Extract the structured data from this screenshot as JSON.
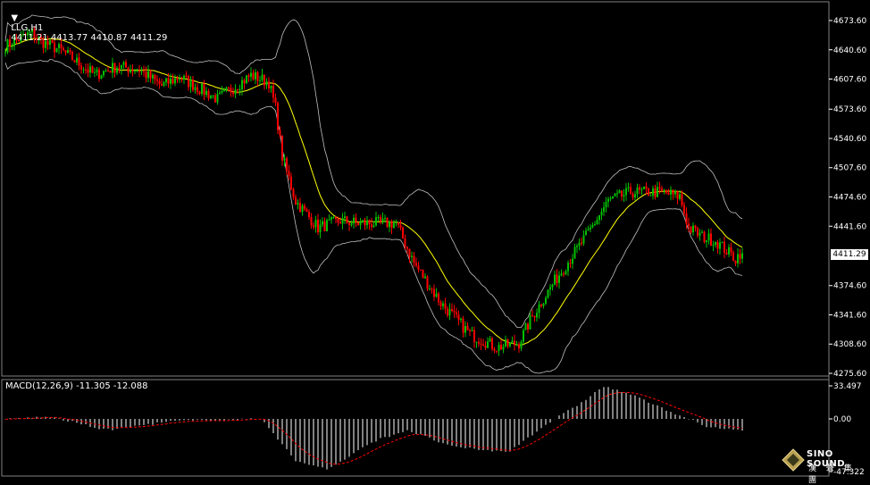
{
  "header": {
    "symbol": "LLG,H1",
    "ohlc": "4411.21 4413.77 4410.87 4411.29"
  },
  "macd_header": "MACD(12,26,9) -11.305 -12.088",
  "price_axis": {
    "ticks": [
      "4673.60",
      "4640.60",
      "4607.60",
      "4573.60",
      "4540.60",
      "4507.60",
      "4474.60",
      "4441.60",
      "4374.60",
      "4341.60",
      "4308.60",
      "4275.60"
    ],
    "current_price": "4411.29"
  },
  "macd_axis": {
    "ticks": [
      "33.497",
      "0.00",
      "-47.322"
    ]
  },
  "logo": {
    "en": "SINO SOUND",
    "zh": "漢 聲 集 團"
  },
  "colors": {
    "background": "#000000",
    "up_candle": "#00c000",
    "down_candle": "#ff0000",
    "middle_band": "#ffff00",
    "bands": "#c0c0c0",
    "macd_hist": "#ffffff",
    "macd_signal": "#ff0000",
    "grid": "#808080"
  },
  "chart_data": {
    "type": "candlestick",
    "title": "LLG,H1",
    "price_range": [
      4275.6,
      4673.6
    ],
    "current_price": 4411.29,
    "bollinger_bands": true,
    "close_anchors": [
      [
        0,
        4645
      ],
      [
        8,
        4655
      ],
      [
        12,
        4660
      ],
      [
        16,
        4650
      ],
      [
        25,
        4640
      ],
      [
        40,
        4612
      ],
      [
        50,
        4622
      ],
      [
        60,
        4618
      ],
      [
        70,
        4600
      ],
      [
        78,
        4610
      ],
      [
        95,
        4585
      ],
      [
        110,
        4612
      ],
      [
        118,
        4604
      ],
      [
        121,
        4575
      ],
      [
        124,
        4520
      ],
      [
        130,
        4470
      ],
      [
        140,
        4440
      ],
      [
        150,
        4448
      ],
      [
        158,
        4445
      ],
      [
        175,
        4445
      ],
      [
        183,
        4400
      ],
      [
        195,
        4355
      ],
      [
        208,
        4320
      ],
      [
        220,
        4305
      ],
      [
        230,
        4310
      ],
      [
        236,
        4340
      ],
      [
        246,
        4380
      ],
      [
        260,
        4430
      ],
      [
        270,
        4470
      ],
      [
        280,
        4480
      ],
      [
        294,
        4480
      ],
      [
        302,
        4475
      ],
      [
        306,
        4440
      ],
      [
        312,
        4430
      ],
      [
        318,
        4425
      ],
      [
        327,
        4405
      ],
      [
        330,
        4415
      ]
    ],
    "macd": {
      "header": "MACD(12,26,9)",
      "main": -11.305,
      "signal": -12.088,
      "range": [
        -47.322,
        33.497
      ],
      "hist_anchors": [
        [
          0,
          0
        ],
        [
          20,
          2
        ],
        [
          45,
          -10
        ],
        [
          75,
          -2
        ],
        [
          115,
          0
        ],
        [
          130,
          -38
        ],
        [
          145,
          -45
        ],
        [
          165,
          -20
        ],
        [
          180,
          -10
        ],
        [
          200,
          -25
        ],
        [
          225,
          -30
        ],
        [
          240,
          -8
        ],
        [
          255,
          12
        ],
        [
          268,
          33
        ],
        [
          280,
          25
        ],
        [
          295,
          10
        ],
        [
          315,
          -8
        ],
        [
          330,
          -10
        ]
      ]
    }
  }
}
